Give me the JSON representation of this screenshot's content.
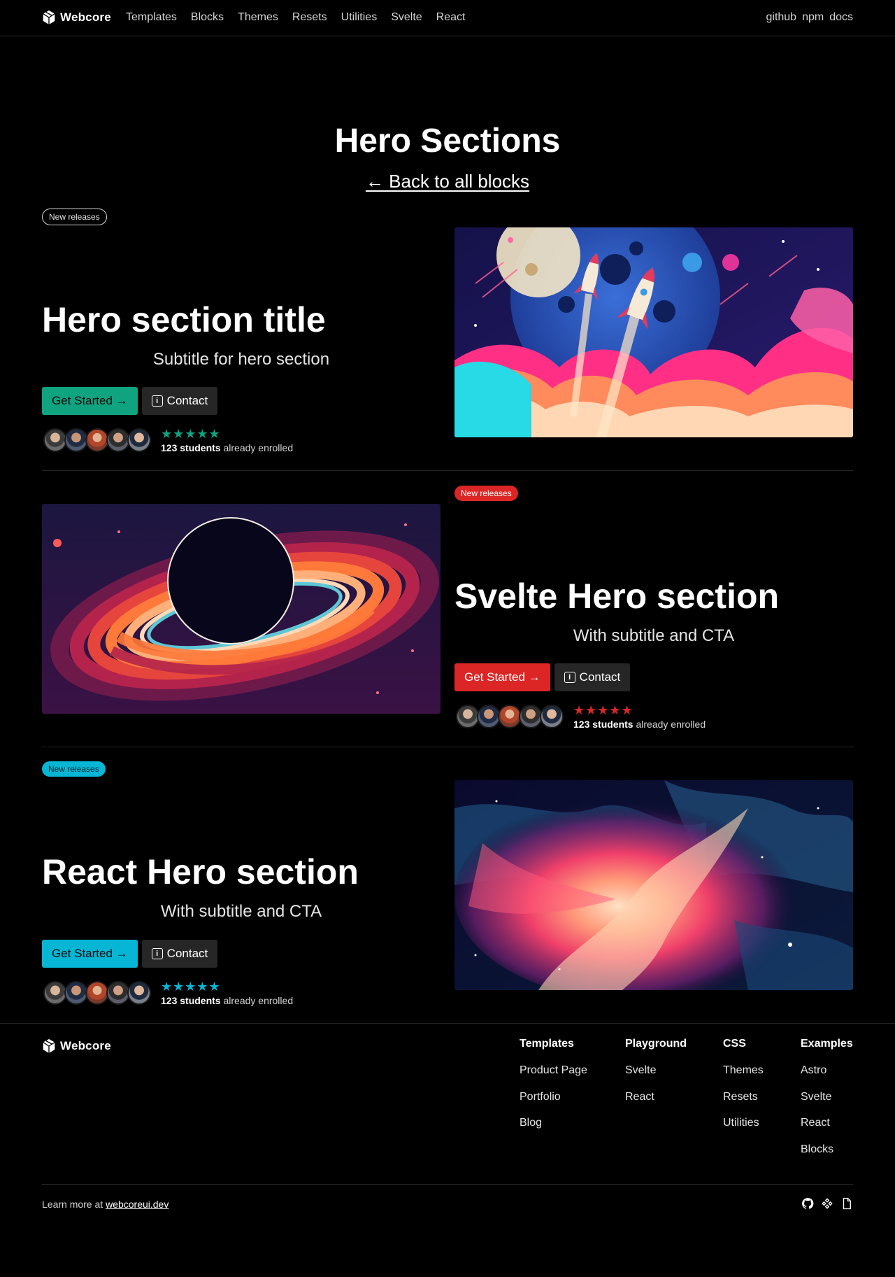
{
  "nav": {
    "brand": "Webcore",
    "links": [
      "Templates",
      "Blocks",
      "Themes",
      "Resets",
      "Utilities",
      "Svelte",
      "React"
    ],
    "right_links": [
      "github",
      "npm",
      "docs"
    ]
  },
  "page": {
    "title": "Hero Sections",
    "back_link": "← Back to all blocks"
  },
  "heroes": [
    {
      "badge": "New releases",
      "title": "Hero section title",
      "subtitle": "Subtitle for hero section",
      "cta_primary": "Get Started →",
      "cta_secondary": "Contact",
      "stars": "★★★★★",
      "students_bold": "123 students",
      "students_rest": " already enrolled",
      "accent": "#10a37f"
    },
    {
      "badge": "New releases",
      "title": "Svelte Hero section",
      "subtitle": "With subtitle and CTA",
      "cta_primary": "Get Started →",
      "cta_secondary": "Contact",
      "stars": "★★★★★",
      "students_bold": "123 students",
      "students_rest": " already enrolled",
      "accent": "#dc2626"
    },
    {
      "badge": "New releases",
      "title": "React Hero section",
      "subtitle": "With subtitle and CTA",
      "cta_primary": "Get Started →",
      "cta_secondary": "Contact",
      "stars": "★★★★★",
      "students_bold": "123 students",
      "students_rest": " already enrolled",
      "accent": "#06b6d4"
    }
  ],
  "footer": {
    "brand": "Webcore",
    "columns": [
      {
        "heading": "Templates",
        "links": [
          "Product Page",
          "Portfolio",
          "Blog"
        ]
      },
      {
        "heading": "Playground",
        "links": [
          "Svelte",
          "React"
        ]
      },
      {
        "heading": "CSS",
        "links": [
          "Themes",
          "Resets",
          "Utilities"
        ]
      },
      {
        "heading": "Examples",
        "links": [
          "Astro",
          "Svelte",
          "React",
          "Blocks"
        ]
      }
    ],
    "learn_prefix": "Learn more at ",
    "learn_link": "webcoreui.dev",
    "social_icons": [
      "github-icon",
      "figma-icon",
      "file-icon"
    ]
  }
}
